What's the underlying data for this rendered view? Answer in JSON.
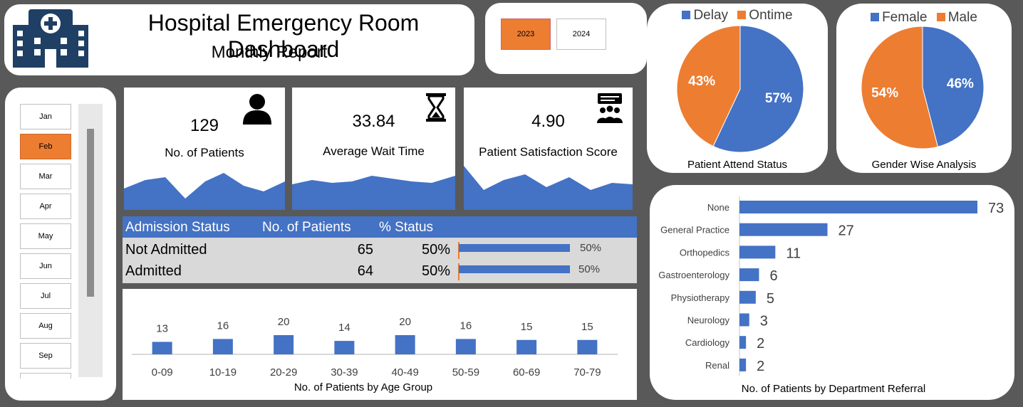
{
  "header": {
    "title": "Hospital Emergency Room Dashboard",
    "subtitle": "Monthly Report",
    "logo_icon": "hospital-icon"
  },
  "years": [
    {
      "label": "2023",
      "selected": true
    },
    {
      "label": "2024",
      "selected": false
    }
  ],
  "months": [
    {
      "label": "Jan",
      "selected": false
    },
    {
      "label": "Feb",
      "selected": true
    },
    {
      "label": "Mar",
      "selected": false
    },
    {
      "label": "Apr",
      "selected": false
    },
    {
      "label": "May",
      "selected": false
    },
    {
      "label": "Jun",
      "selected": false
    },
    {
      "label": "Jul",
      "selected": false
    },
    {
      "label": "Aug",
      "selected": false
    },
    {
      "label": "Sep",
      "selected": false
    },
    {
      "label": "",
      "selected": false
    }
  ],
  "kpis": [
    {
      "value": "129",
      "label": "No. of Patients",
      "icon": "person-icon"
    },
    {
      "value": "33.84",
      "label": "Average Wait Time",
      "icon": "hourglass-icon"
    },
    {
      "value": "4.90",
      "label": "Patient Satisfaction Score",
      "icon": "people-feedback-icon"
    }
  ],
  "admission": {
    "headers": [
      "Admission Status",
      "No. of Patients",
      "% Status"
    ],
    "rows": [
      {
        "status": "Not Admitted",
        "patients": "65",
        "pct": "50%",
        "bar_label": "50%",
        "bar_fraction": 0.5
      },
      {
        "status": "Admitted",
        "patients": "64",
        "pct": "50%",
        "bar_label": "50%",
        "bar_fraction": 0.5
      }
    ]
  },
  "colors": {
    "blue": "#4472c4",
    "orange": "#ed7d31"
  },
  "chart_data": [
    {
      "type": "pie",
      "title": "Patient Attend Status",
      "legend": [
        "Delay",
        "Ontime"
      ],
      "slices": [
        {
          "name": "Delay",
          "value": 57,
          "label": "57%",
          "color": "#4472c4"
        },
        {
          "name": "Ontime",
          "value": 43,
          "label": "43%",
          "color": "#ed7d31"
        }
      ],
      "legend_position": "top"
    },
    {
      "type": "pie",
      "title": "Gender Wise Analysis",
      "legend": [
        "Female",
        "Male"
      ],
      "slices": [
        {
          "name": "Female",
          "value": 46,
          "label": "46%",
          "color": "#4472c4"
        },
        {
          "name": "Male",
          "value": 54,
          "label": "54%",
          "color": "#ed7d31"
        }
      ],
      "legend_position": "top"
    },
    {
      "type": "bar",
      "title": "No. of Patients by Age Group",
      "categories": [
        "0-09",
        "10-19",
        "20-29",
        "30-39",
        "40-49",
        "50-59",
        "60-69",
        "70-79"
      ],
      "values": [
        13,
        16,
        20,
        14,
        20,
        16,
        15,
        15
      ],
      "ylim": [
        0,
        80
      ],
      "grid": false
    },
    {
      "type": "bar",
      "orientation": "horizontal",
      "title": "No. of Patients by Department Referral",
      "categories": [
        "None",
        "General Practice",
        "Orthopedics",
        "Gastroenterology",
        "Physiotherapy",
        "Neurology",
        "Cardiology",
        "Renal"
      ],
      "values": [
        73,
        27,
        11,
        6,
        5,
        3,
        2,
        2
      ],
      "xlim": [
        0,
        73
      ],
      "grid": false
    }
  ]
}
